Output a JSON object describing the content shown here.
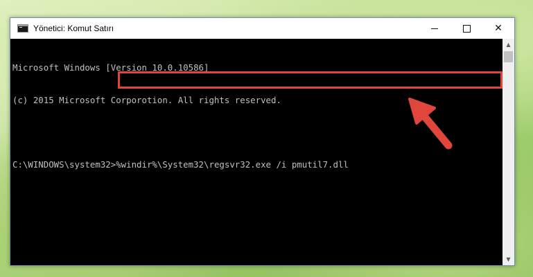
{
  "window": {
    "title": "Yönetici: Komut Satırı",
    "controls": {
      "minimize": "–",
      "maximize": "□",
      "close": "✕"
    }
  },
  "console": {
    "lines": [
      "Microsoft Windows [Version 10.0.10586]",
      "(c) 2015 Microsoft Corporotion. All rights reserved."
    ],
    "prompt": "C:\\WINDOWS\\system32>",
    "command": "%windir%\\System32\\regsvr32.exe /i pmutil7.dll"
  },
  "scrollbar": {
    "up_icon": "▲",
    "down_icon": "▼"
  },
  "colors": {
    "highlight": "#e0463c",
    "console_background": "#000000",
    "console_text": "#c0c0c0"
  },
  "annotation": {
    "icon": "red-arrow-icon"
  }
}
